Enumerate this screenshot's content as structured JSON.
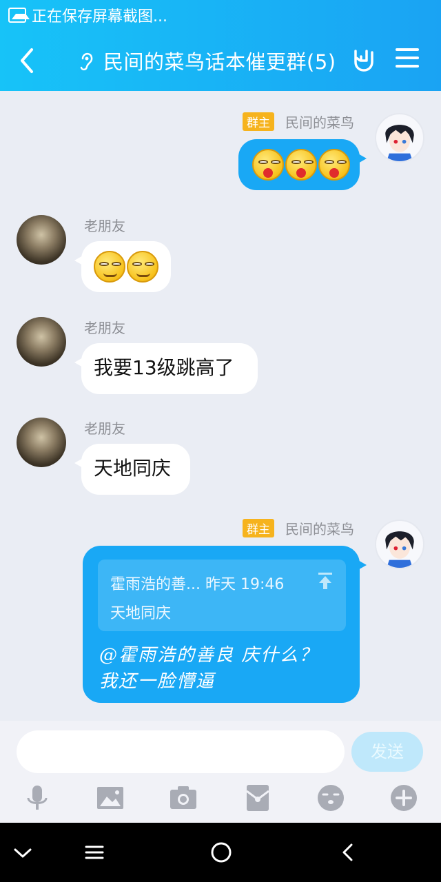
{
  "status_bar": {
    "text": "正在保存屏幕截图..."
  },
  "header": {
    "title": "民间的菜鸟话本催更群(5)",
    "colors": {
      "gradient_start": "#17c3f8",
      "gradient_end": "#1aa3f3"
    }
  },
  "messages": [
    {
      "sender": "民间的菜鸟",
      "badge": "群主",
      "side": "right",
      "kind": "emoji",
      "emoji": [
        "bleeding-face-emoji",
        "bleeding-face-emoji",
        "bleeding-face-emoji"
      ]
    },
    {
      "sender": "老朋友",
      "side": "left",
      "kind": "emoji",
      "emoji": [
        "smirk-emoji",
        "smirk-emoji"
      ]
    },
    {
      "sender": "老朋友",
      "side": "left",
      "kind": "text",
      "text": "我要13级跳高了"
    },
    {
      "sender": "老朋友",
      "side": "left",
      "kind": "text",
      "text": "天地同庆"
    },
    {
      "sender": "民间的菜鸟",
      "badge": "群主",
      "side": "right",
      "kind": "reply",
      "quote": {
        "header": "霍雨浩的善... 昨天 19:46",
        "body": "天地同庆"
      },
      "lines": [
        "@霍雨浩的善良 庆什么？",
        "我还一脸懵逼"
      ]
    }
  ],
  "composer": {
    "placeholder": "",
    "send_label": "发送",
    "tools": [
      "microphone-icon",
      "image-icon",
      "camera-icon",
      "red-packet-icon",
      "emoji-icon",
      "plus-icon"
    ]
  },
  "nav_bar": {
    "buttons": [
      "chevron-down-icon",
      "menu-icon",
      "home-icon",
      "back-icon"
    ]
  }
}
